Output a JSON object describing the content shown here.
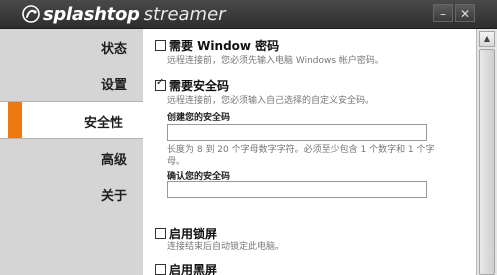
{
  "app": {
    "brand": "splashtop",
    "product": "streamer"
  },
  "window_buttons": {
    "minimize": "–",
    "close": "✕"
  },
  "sidebar": {
    "items": [
      {
        "label": "状态",
        "active": false
      },
      {
        "label": "设置",
        "active": false
      },
      {
        "label": "安全性",
        "active": true
      },
      {
        "label": "高级",
        "active": false
      },
      {
        "label": "关于",
        "active": false
      }
    ]
  },
  "security": {
    "windows_password": {
      "label": "需要 Window 密码",
      "checked": false,
      "hint": "远程连接前，您必须先输入电脑 Windows 帐户密码。"
    },
    "security_code": {
      "label": "需要安全码",
      "checked": true,
      "hint": "远程连接前，您必须输入自己选择的自定义安全码。",
      "create_label": "创建您的安全码",
      "create_value": "",
      "rule_hint": "长度为 8 到 20 个字母数字字符。必须至少包含 1 个数字和 1 个字母。",
      "confirm_label": "确认您的安全码",
      "confirm_value": ""
    },
    "lock_screen": {
      "label": "启用锁屏",
      "checked": false,
      "hint": "连接结束后自动锁定此电脑。"
    },
    "black_screen": {
      "label": "启用黑屏",
      "checked": false
    }
  },
  "colors": {
    "accent": "#f07810",
    "titlebar": "#3a3a3a"
  }
}
